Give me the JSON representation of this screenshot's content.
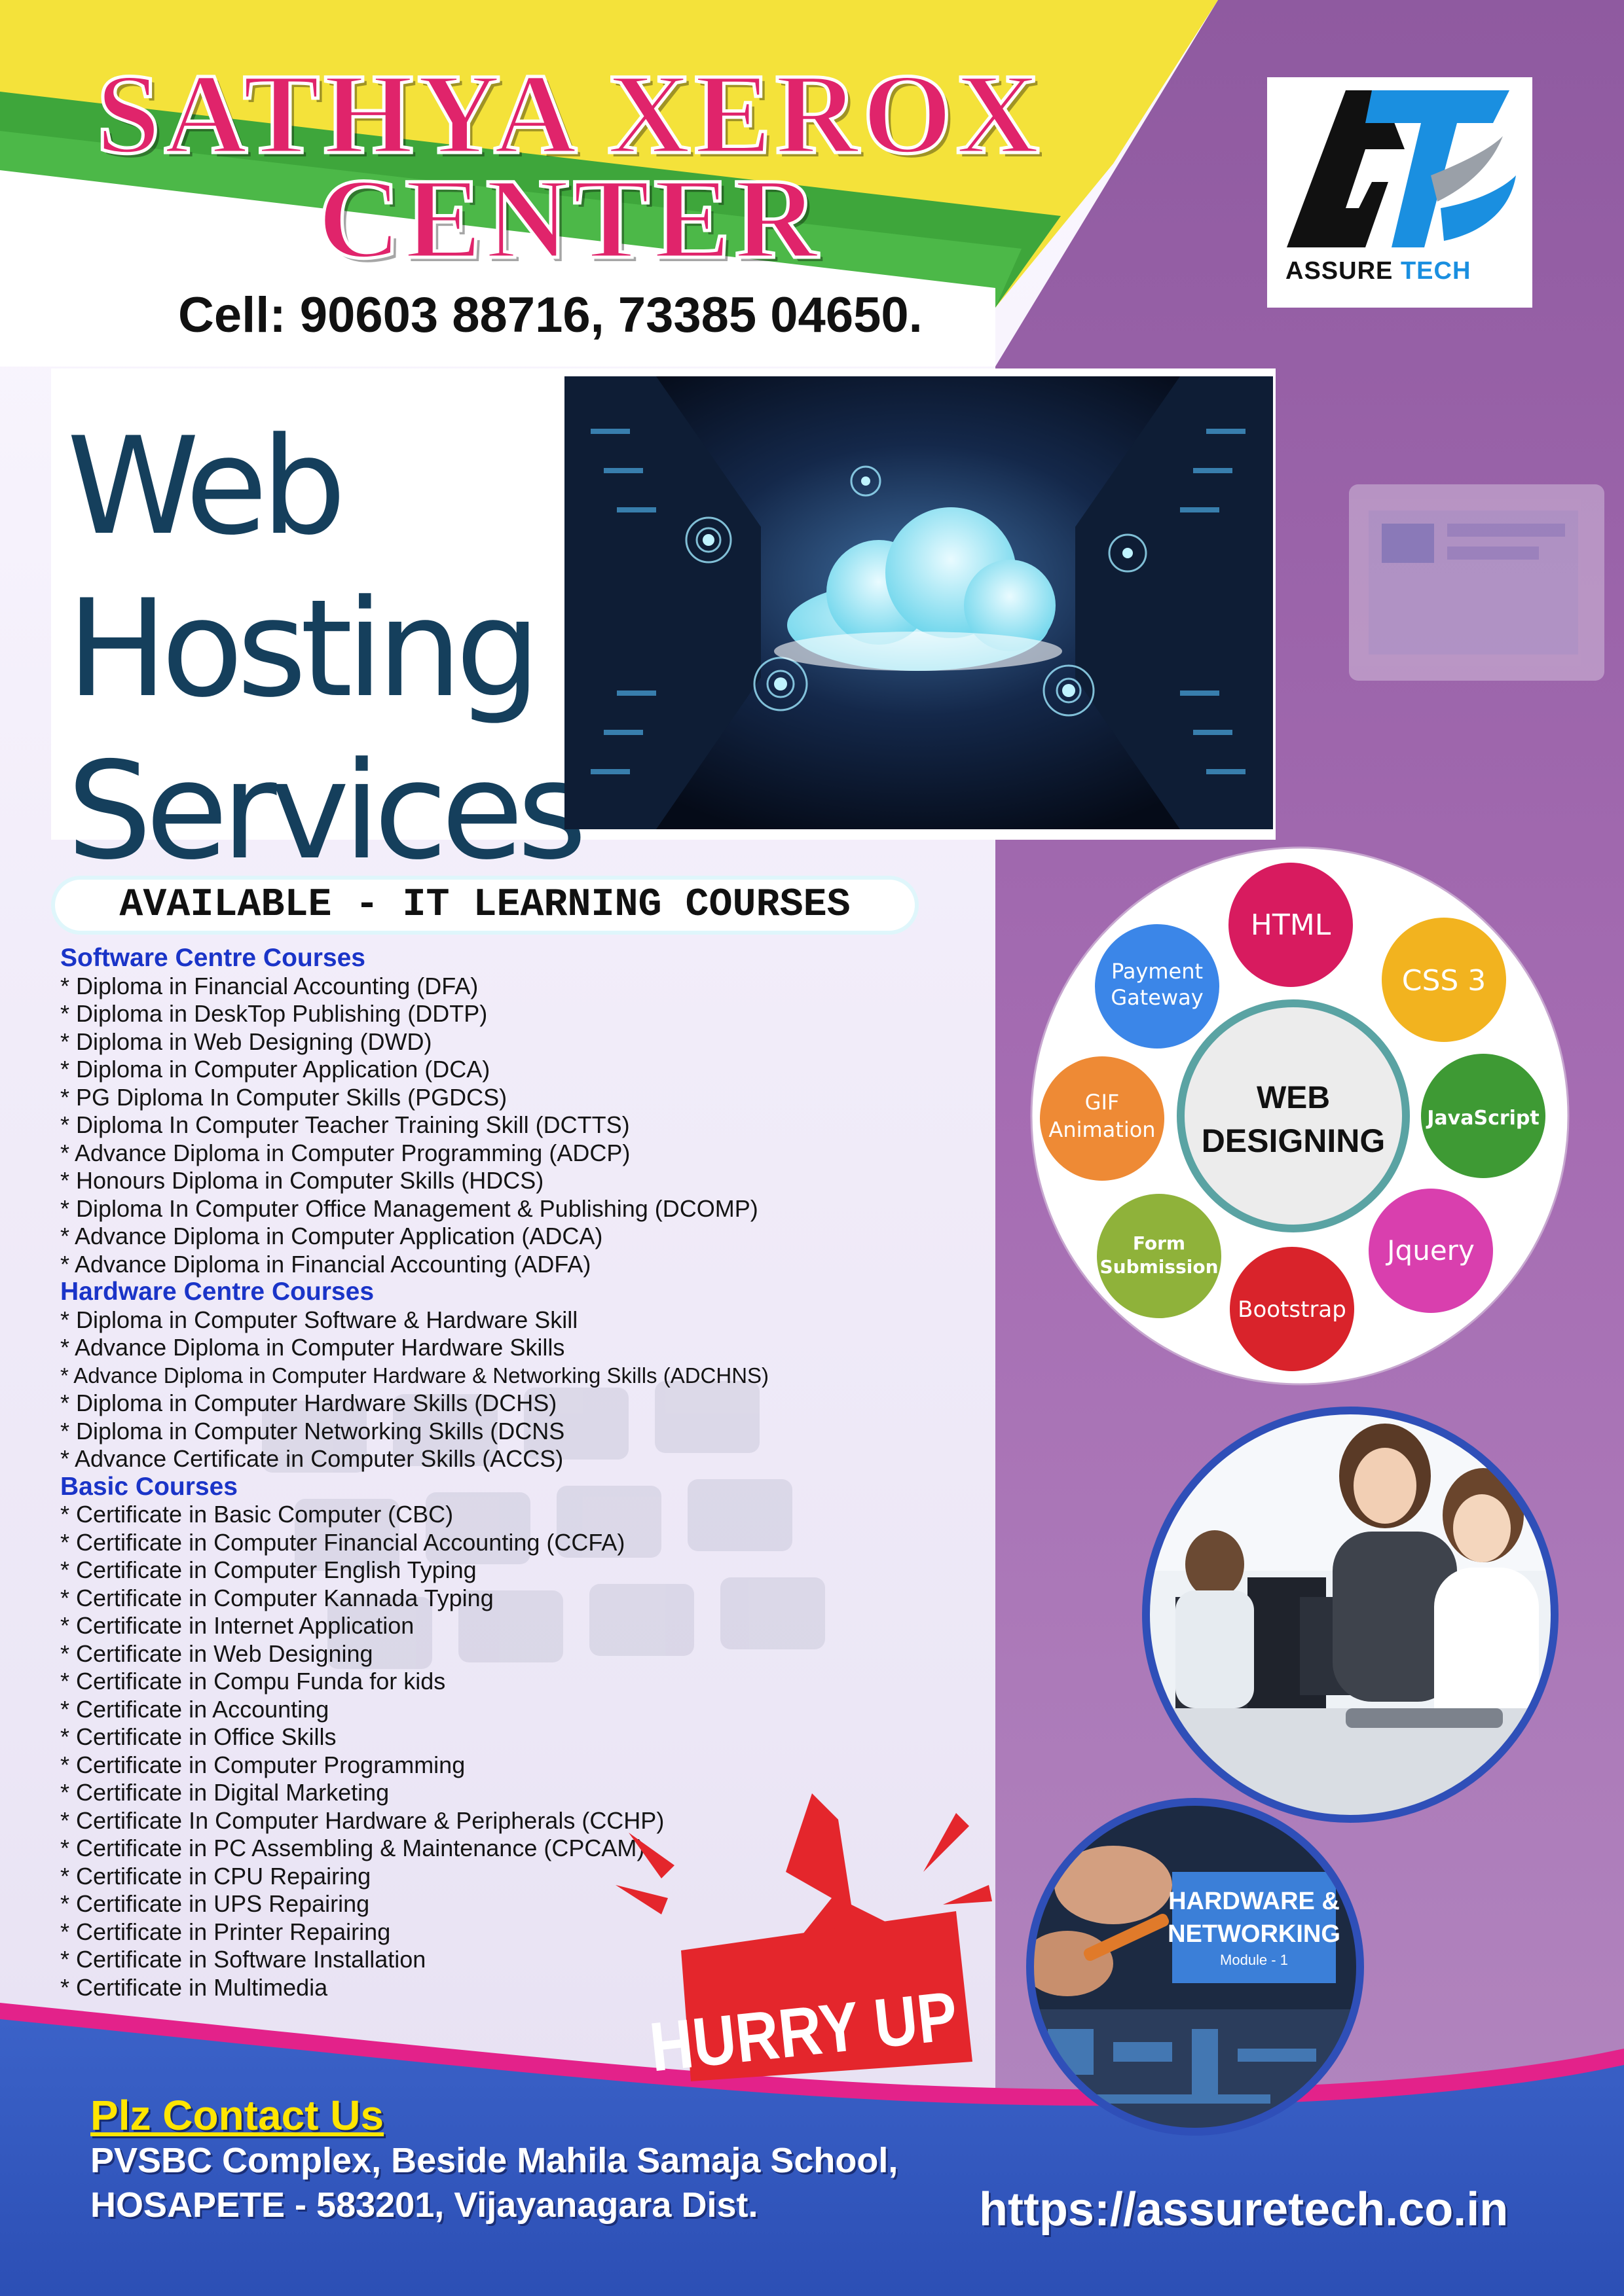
{
  "header": {
    "title_line1": "SATHYA XEROX",
    "title_line2": "CENTER",
    "phone": "Cell: 90603 88716, 73385 04650."
  },
  "logo": {
    "text_assure": "ASSURE",
    "text_tech": "TECH",
    "icon": "at-monogram-icon"
  },
  "hosting": {
    "line1": "Web",
    "line2": "Hosting",
    "line3": "Services"
  },
  "courses": {
    "heading": "AVAILABLE - IT LEARNING COURSES",
    "software": {
      "title": "Software Centre Courses",
      "items": [
        "* Diploma in Financial Accounting (DFA)",
        "* Diploma in DeskTop Publishing (DDTP)",
        "* Diploma in Web Designing (DWD)",
        "* Diploma in Computer Application (DCA)",
        "* PG Diploma In Computer Skills (PGDCS)",
        "* Diploma In Computer Teacher Training Skill (DCTTS)",
        "* Advance Diploma in Computer Programming (ADCP)",
        "* Honours Diploma in Computer Skills (HDCS)",
        "* Diploma In Computer Office Management & Publishing (DCOMP)",
        "* Advance Diploma in Computer Application (ADCA)",
        "* Advance Diploma in Financial Accounting (ADFA)"
      ]
    },
    "hardware": {
      "title": "Hardware Centre Courses",
      "items": [
        "* Diploma in Computer Software & Hardware Skill",
        "* Advance Diploma in Computer Hardware Skills",
        "* Advance Diploma in Computer Hardware & Networking Skills (ADCHNS)",
        "* Diploma in Computer Hardware Skills (DCHS)",
        "* Diploma in Computer Networking Skills (DCNS",
        "* Advance Certificate in Computer Skills (ACCS)"
      ]
    },
    "basic": {
      "title": "Basic Courses",
      "items": [
        "* Certificate in Basic Computer (CBC)",
        "* Certificate in Computer Financial Accounting (CCFA)",
        "* Certificate in Computer English Typing",
        "* Certificate in Computer Kannada Typing",
        "* Certificate in Internet Application",
        "* Certificate in Web Designing",
        "* Certificate in Compu Funda for kids",
        "* Certificate in Accounting",
        "* Certificate in Office Skills",
        "* Certificate in Computer Programming",
        "* Certificate in Digital Marketing",
        "* Certificate In Computer Hardware & Peripherals (CCHP)",
        "* Certificate in PC Assembling & Maintenance (CPCAM)",
        "* Certificate in CPU Repairing",
        "* Certificate in UPS Repairing",
        "* Certificate in Printer Repairing",
        "* Certificate in Software Installation",
        "* Certificate in Multimedia"
      ]
    }
  },
  "web_design": {
    "center_line1": "WEB",
    "center_line2": "DESIGNING",
    "nodes": {
      "html": "HTML",
      "css": "CSS 3",
      "javascript": "JavaScript",
      "jquery": "Jquery",
      "bootstrap": "Bootstrap",
      "form_line1": "Form",
      "form_line2": "Submission",
      "gif_line1": "GIF",
      "gif_line2": "Animation",
      "payment_line1": "Payment",
      "payment_line2": "Gateway"
    },
    "colors": {
      "html": "#d81b5f",
      "css": "#f2b31f",
      "javascript": "#3e9a34",
      "jquery": "#d93fae",
      "bootstrap": "#d9232b",
      "form": "#8fb23a",
      "gif": "#ee8a35",
      "payment": "#3b86e8",
      "ring": "#5aa3a3"
    }
  },
  "hardware_badge": {
    "line1": "HARDWARE &",
    "line2": "NETWORKING",
    "line3": "Module - 1"
  },
  "hurry": {
    "label": "HURRY UP"
  },
  "contact": {
    "heading": "Plz Contact Us",
    "address_line1": "PVSBC Complex, Beside Mahila Samaja School,",
    "address_line2": "HOSAPETE - 583201, Vijayanagara Dist.",
    "website": "https://assuretech.co.in"
  }
}
